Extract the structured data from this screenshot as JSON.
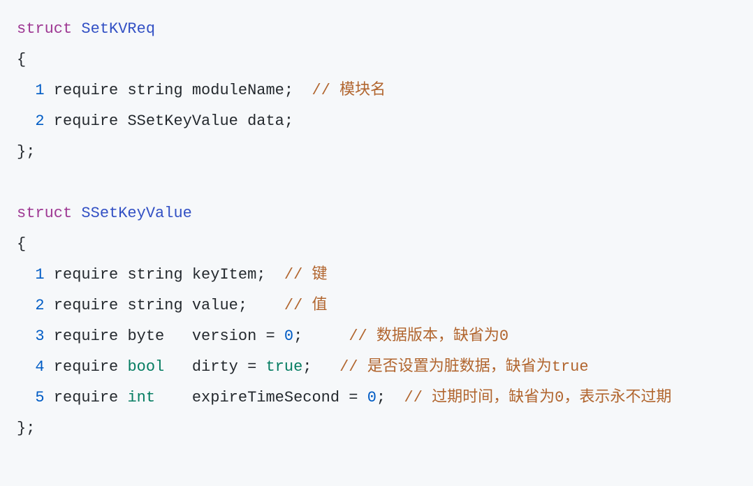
{
  "code": {
    "struct1": {
      "kw": "struct",
      "name": "SetKVReq",
      "open": "{",
      "lines": [
        {
          "indent": "  ",
          "num": "1",
          "require": " require ",
          "type": "string",
          "rest": " moduleName;  ",
          "comment": "// 模块名"
        },
        {
          "indent": "  ",
          "num": "2",
          "require": " require ",
          "type": "SSetKeyValue",
          "rest": " data;",
          "comment": ""
        }
      ],
      "close": "};"
    },
    "struct2": {
      "kw": "struct",
      "name": "SSetKeyValue",
      "open": "{",
      "lines": [
        {
          "indent": "  ",
          "num": "1",
          "require": " require ",
          "type": "string",
          "rest": " keyItem;  ",
          "comment": "// 键"
        },
        {
          "indent": "  ",
          "num": "2",
          "require": " require ",
          "type": "string",
          "rest": " value;    ",
          "comment": "// 值"
        },
        {
          "indent": "  ",
          "num": "3",
          "require": " require ",
          "type": "byte",
          "rest1": "   version = ",
          "val": "0",
          "rest2": ";     ",
          "comment": "// 数据版本，缺省为0"
        },
        {
          "indent": "  ",
          "num": "4",
          "require": " require ",
          "type_builtin": "bool",
          "rest1": "   dirty = ",
          "val_builtin": "true",
          "rest2": ";   ",
          "comment": "// 是否设置为脏数据，缺省为true"
        },
        {
          "indent": "  ",
          "num": "5",
          "require": " require ",
          "type_builtin": "int",
          "rest1": "    expireTimeSecond = ",
          "val": "0",
          "rest2": ";  ",
          "comment": "// 过期时间，缺省为0，表示永不过期"
        }
      ],
      "close": "};"
    }
  }
}
